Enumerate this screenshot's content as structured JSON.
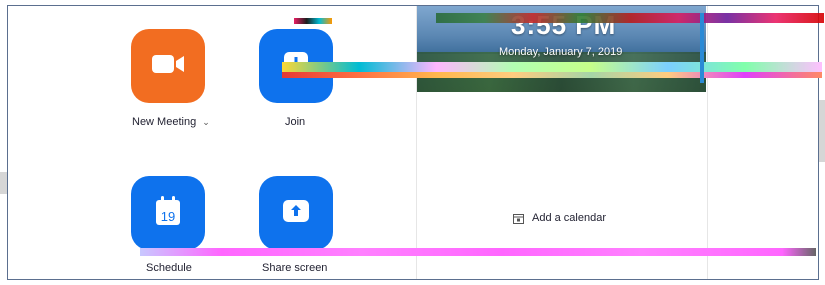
{
  "actions": {
    "new_meeting": {
      "label": "New Meeting",
      "icon": "video-camera-icon",
      "color": "#f26d21"
    },
    "join": {
      "label": "Join",
      "icon": "plus-icon",
      "color": "#0e72ed"
    },
    "schedule": {
      "label": "Schedule",
      "icon": "calendar-icon",
      "day": "19",
      "color": "#0e72ed"
    },
    "share_screen": {
      "label": "Share screen",
      "icon": "upload-arrow-icon",
      "color": "#0e72ed"
    }
  },
  "clock": {
    "time": "3:55 PM",
    "date": "Monday, January 7, 2019"
  },
  "calendar": {
    "add_label": "Add a calendar"
  }
}
